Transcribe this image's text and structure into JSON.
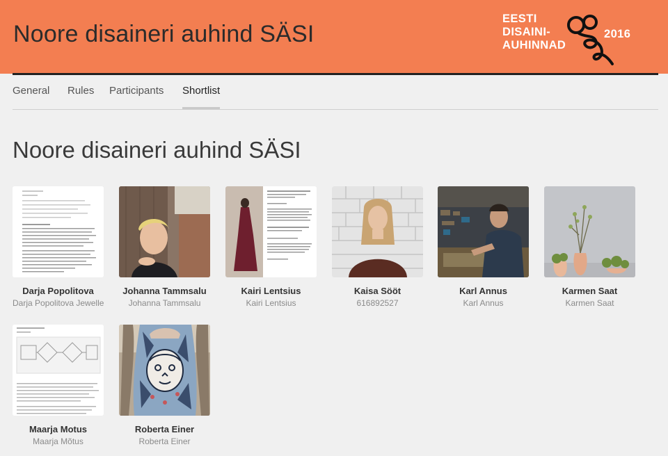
{
  "header": {
    "title": "Noore disaineri auhind SÄSI",
    "logo_lines": [
      "EESTI",
      "DISAINI-",
      "AUHINNAD"
    ],
    "logo_year": "2016",
    "background_color": "#f37e51"
  },
  "tabs": [
    {
      "label": "General",
      "active": false
    },
    {
      "label": "Rules",
      "active": false
    },
    {
      "label": "Participants",
      "active": false
    },
    {
      "label": "Shortlist",
      "active": true
    }
  ],
  "page": {
    "heading": "Noore disaineri auhind SÄSI"
  },
  "participants": [
    {
      "name": "Darja Popolitova",
      "subtitle": "Darja Popolitova Jewelle",
      "thumbnail": "document-page"
    },
    {
      "name": "Johanna Tammsalu",
      "subtitle": "Johanna Tammsalu",
      "thumbnail": "portrait-photo"
    },
    {
      "name": "Kairi Lentsius",
      "subtitle": "Kairi Lentsius",
      "thumbnail": "dress-and-document"
    },
    {
      "name": "Kaisa Sööt",
      "subtitle": "616892527",
      "thumbnail": "portrait-photo"
    },
    {
      "name": "Karl Annus",
      "subtitle": "Karl Annus",
      "thumbnail": "workshop-photo"
    },
    {
      "name": "Karmen Saat",
      "subtitle": "Karmen Saat",
      "thumbnail": "vases-photo"
    },
    {
      "name": "Maarja Motus",
      "subtitle": "Maarja Mõtus",
      "thumbnail": "diagram-document"
    },
    {
      "name": "Roberta Einer",
      "subtitle": "Roberta Einer",
      "thumbnail": "fashion-photo"
    }
  ]
}
